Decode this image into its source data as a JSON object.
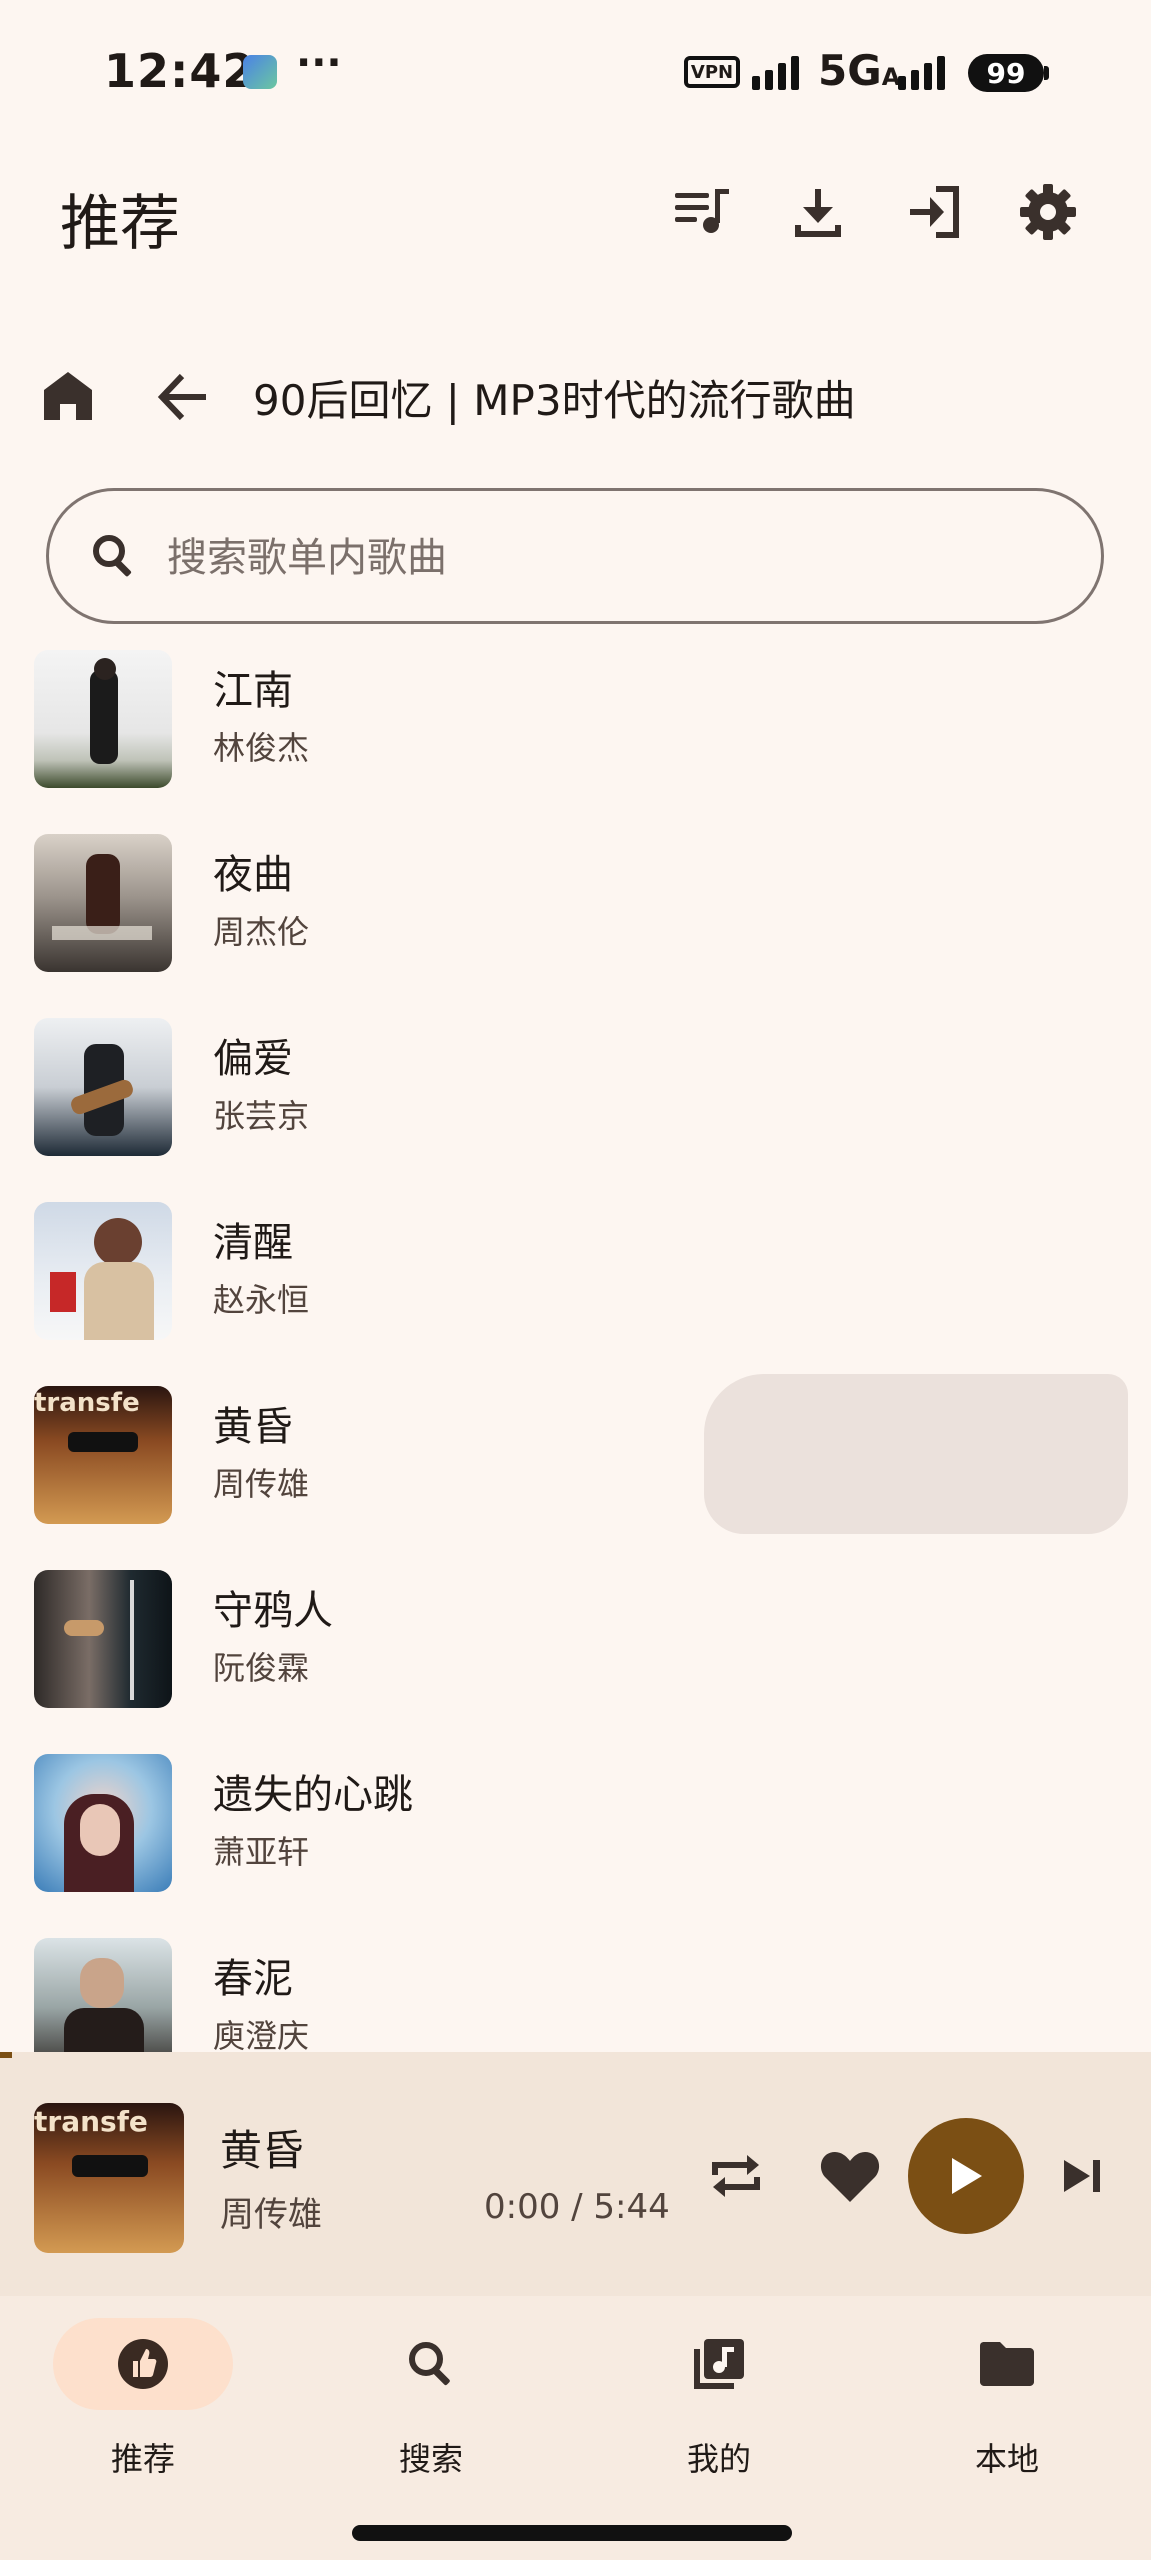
{
  "status_bar": {
    "time": "12:42",
    "more": "···",
    "vpn": "VPN",
    "network": "5G",
    "network_suffix": "A",
    "battery": "99"
  },
  "app_bar": {
    "title": "推荐",
    "icons": [
      "queue-music-icon",
      "download-icon",
      "login-icon",
      "settings-icon"
    ]
  },
  "breadcrumb": {
    "title": "90后回忆 | MP3时代的流行歌曲"
  },
  "search": {
    "placeholder": "搜索歌单内歌曲",
    "value": ""
  },
  "songs": [
    {
      "title": "江南",
      "artist": "林俊杰"
    },
    {
      "title": "夜曲",
      "artist": "周杰伦"
    },
    {
      "title": "偏爱",
      "artist": "张芸京"
    },
    {
      "title": "清醒",
      "artist": "赵永恒"
    },
    {
      "title": "黄昏",
      "artist": "周传雄"
    },
    {
      "title": "守鸦人",
      "artist": "阮俊霖"
    },
    {
      "title": "遗失的心跳",
      "artist": "萧亚轩"
    },
    {
      "title": "春泥",
      "artist": "庾澄庆"
    }
  ],
  "player": {
    "title": "黄昏",
    "artist": "周传雄",
    "time": "0:00 / 5:44",
    "accent": "#7b4f14"
  },
  "bottom_nav": [
    {
      "label": "推荐",
      "icon": "thumb-up-icon",
      "active": true
    },
    {
      "label": "搜索",
      "icon": "search-icon",
      "active": false
    },
    {
      "label": "我的",
      "icon": "library-music-icon",
      "active": false
    },
    {
      "label": "本地",
      "icon": "folder-icon",
      "active": false
    }
  ],
  "colors": {
    "background": "#fdf6f1",
    "active_pill": "#fde0cc",
    "player_bg": "#f2e5d9"
  }
}
